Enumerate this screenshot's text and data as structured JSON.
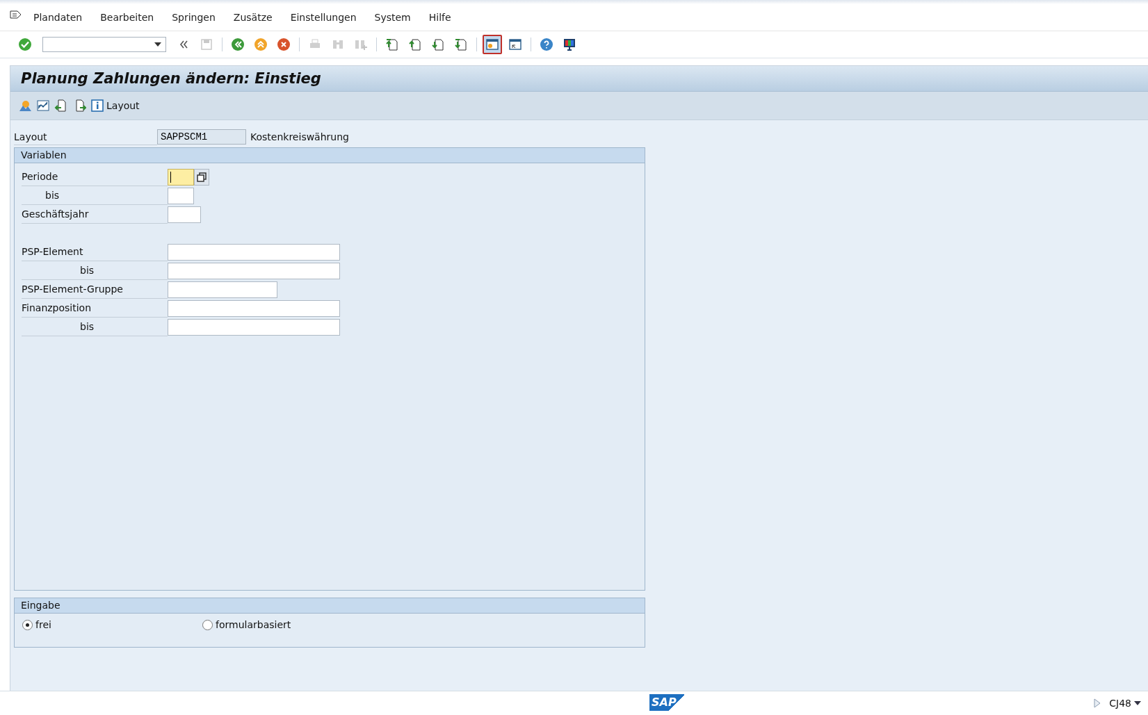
{
  "menu": [
    {
      "label": "Plandaten"
    },
    {
      "label": "Bearbeiten"
    },
    {
      "label": "Springen"
    },
    {
      "label": "Zusätze"
    },
    {
      "label": "Einstellungen"
    },
    {
      "label": "System"
    },
    {
      "label": "Hilfe"
    }
  ],
  "toolbar": [
    {
      "kind": "enter",
      "disabled": false,
      "focused": false
    },
    {
      "kind": "command",
      "disabled": false,
      "focused": false
    },
    {
      "kind": "collapse",
      "disabled": false,
      "focused": false
    },
    {
      "kind": "save",
      "disabled": true,
      "focused": false
    },
    {
      "kind": "sep"
    },
    {
      "kind": "back",
      "disabled": false,
      "focused": false
    },
    {
      "kind": "exit",
      "disabled": false,
      "focused": false
    },
    {
      "kind": "cancel",
      "disabled": false,
      "focused": false
    },
    {
      "kind": "sep"
    },
    {
      "kind": "print",
      "disabled": true,
      "focused": false
    },
    {
      "kind": "find",
      "disabled": true,
      "focused": false
    },
    {
      "kind": "find_next",
      "disabled": true,
      "focused": false
    },
    {
      "kind": "sep"
    },
    {
      "kind": "first",
      "disabled": false,
      "focused": false
    },
    {
      "kind": "prev",
      "disabled": false,
      "focused": false
    },
    {
      "kind": "next",
      "disabled": false,
      "focused": false
    },
    {
      "kind": "last",
      "disabled": false,
      "focused": false
    },
    {
      "kind": "sep"
    },
    {
      "kind": "new_session",
      "disabled": false,
      "focused": true
    },
    {
      "kind": "shortcut",
      "disabled": false,
      "focused": false
    },
    {
      "kind": "sep"
    },
    {
      "kind": "help",
      "disabled": false,
      "focused": false
    },
    {
      "kind": "customize",
      "disabled": false,
      "focused": false
    }
  ],
  "title": "Planung Zahlungen ändern: Einstieg",
  "app_toolbar": [
    {
      "kind": "chart"
    },
    {
      "kind": "graph"
    },
    {
      "kind": "import"
    },
    {
      "kind": "export"
    },
    {
      "kind": "info",
      "label": "Layout"
    }
  ],
  "layout": {
    "label": "Layout",
    "value": "SAPPSCM1",
    "description": "Kostenkreiswährung"
  },
  "variables": {
    "title": "Variablen",
    "rows": [
      {
        "kind": "period",
        "label": "Periode",
        "focused": true
      },
      {
        "kind": "period_to",
        "label": "bis",
        "focused": false
      },
      {
        "kind": "year",
        "label": "Geschäftsjahr",
        "focused": false
      },
      {
        "kind": "object",
        "label": "PSP-Element",
        "focused": false
      },
      {
        "kind": "object_to",
        "label": "bis",
        "focused": false
      },
      {
        "kind": "group",
        "label": "PSP-Element-Gruppe",
        "focused": false
      },
      {
        "kind": "position",
        "label": "Finanzposition",
        "focused": false
      },
      {
        "kind": "position_to",
        "label": "bis",
        "focused": false
      }
    ]
  },
  "input": {
    "title": "Eingabe",
    "options": [
      {
        "label": "frei",
        "selected": true
      },
      {
        "label": "formularbasiert",
        "selected": false
      }
    ]
  },
  "status_bar": {
    "logo": "SAP",
    "transaction": "CJ48"
  }
}
